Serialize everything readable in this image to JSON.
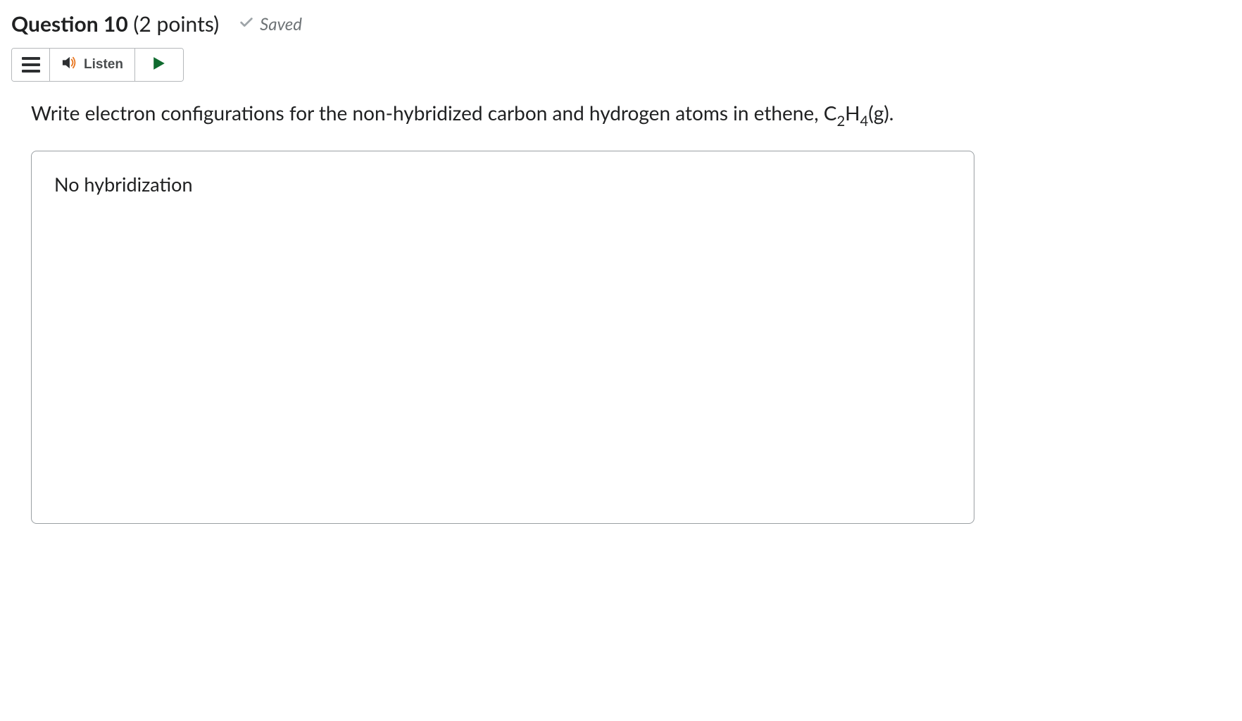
{
  "header": {
    "question_label": "Question 10",
    "points_label": "(2 points)",
    "saved_label": "Saved"
  },
  "toolbar": {
    "listen_label": "Listen"
  },
  "question": {
    "text_prefix": "Write electron configurations for the non-hybridized carbon and hydrogen atoms in ethene, C",
    "sub1": "2",
    "mid": "H",
    "sub2": "4",
    "suffix": "(g)."
  },
  "answer": {
    "value": "No hybridization"
  }
}
